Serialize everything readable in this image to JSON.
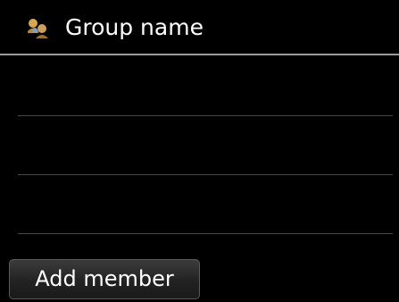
{
  "header": {
    "title": "Group name",
    "icon": "group-contact-icon"
  },
  "member_list": {
    "rows": [
      "",
      "",
      ""
    ]
  },
  "actions": {
    "add_member_label": "Add member"
  },
  "colors": {
    "background": "#000000",
    "text": "#ffffff",
    "icon_accent": "#c89a3c"
  }
}
